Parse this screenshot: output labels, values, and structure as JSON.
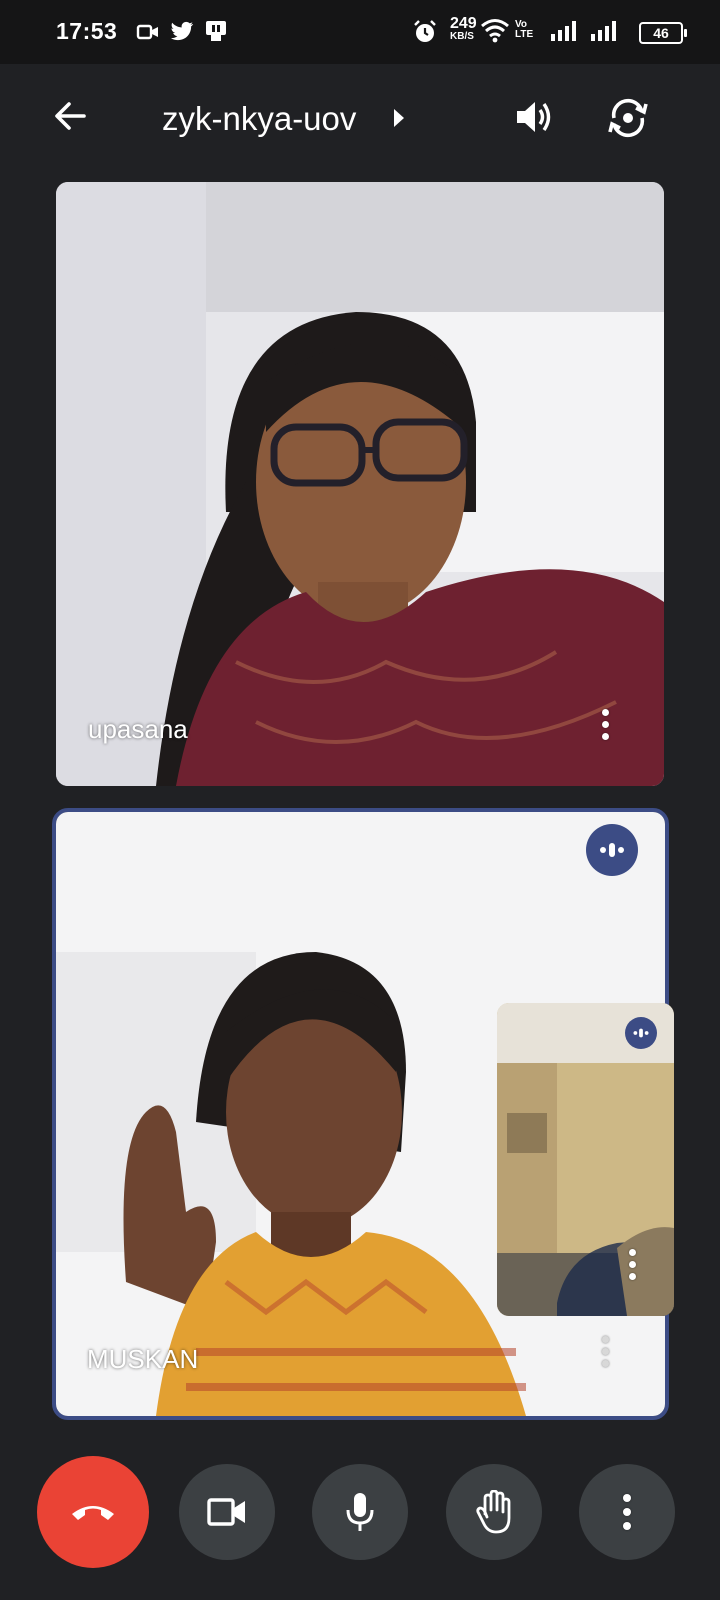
{
  "status_bar": {
    "time": "17:53",
    "speed_value": "249",
    "speed_unit": "KB/S",
    "volte": "Vo LTE",
    "battery": "46",
    "icons": [
      "camera-icon",
      "twitter-icon",
      "message-icon",
      "alarm-icon",
      "wifi-icon",
      "signal-icon"
    ]
  },
  "top_bar": {
    "meeting_code": "zyk-nkya-uov",
    "icons": [
      "back-arrow-icon",
      "expand-chevron-icon",
      "speaker-icon",
      "switch-camera-icon"
    ]
  },
  "participants": [
    {
      "name": "upasana",
      "speaking": false
    },
    {
      "name": "MUSKAN",
      "speaking": true
    }
  ],
  "self_view": {
    "speaking": true
  },
  "controls": {
    "icons": [
      "end-call-icon",
      "camera-icon",
      "mic-icon",
      "raise-hand-icon",
      "more-options-icon"
    ]
  },
  "colors": {
    "background": "#202124",
    "status_bar": "#151516",
    "active_speaker_border": "#3c4c85",
    "end_call": "#ea4335",
    "control_button": "#3c4043"
  }
}
